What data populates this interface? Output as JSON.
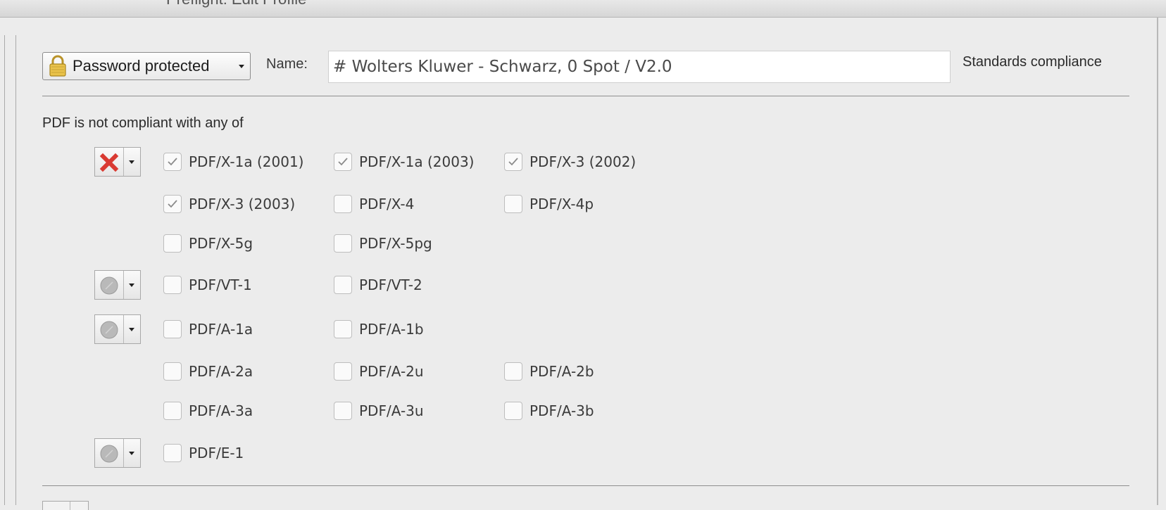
{
  "window": {
    "title": "Preflight: Edit Profile"
  },
  "header": {
    "lock_popup": {
      "label": "Password protected",
      "icon": "lock-icon"
    },
    "name_label": "Name:",
    "name_value": "# Wolters Kluwer - Schwarz, 0 Spot / V2.0",
    "section_title": "Standards compliance"
  },
  "compliance": {
    "intro": "PDF is not compliant with any of",
    "groups": [
      {
        "status": "error",
        "status_icon": "red-x-icon",
        "items": [
          {
            "label": "PDF/X-1a (2001)",
            "checked": true
          },
          {
            "label": "PDF/X-1a (2003)",
            "checked": true
          },
          {
            "label": "PDF/X-3 (2002)",
            "checked": true
          },
          {
            "label": "PDF/X-3 (2003)",
            "checked": true
          },
          {
            "label": "PDF/X-4",
            "checked": false
          },
          {
            "label": "PDF/X-4p",
            "checked": false
          },
          {
            "label": "PDF/X-5g",
            "checked": false
          },
          {
            "label": "PDF/X-5pg",
            "checked": false
          }
        ]
      },
      {
        "status": "inactive",
        "status_icon": "gray-circle-icon",
        "items": [
          {
            "label": "PDF/VT-1",
            "checked": false
          },
          {
            "label": "PDF/VT-2",
            "checked": false
          }
        ]
      },
      {
        "status": "inactive",
        "status_icon": "gray-circle-icon",
        "items": [
          {
            "label": "PDF/A-1a",
            "checked": false
          },
          {
            "label": "PDF/A-1b",
            "checked": false
          },
          {
            "label": "PDF/A-2a",
            "checked": false
          },
          {
            "label": "PDF/A-2u",
            "checked": false
          },
          {
            "label": "PDF/A-2b",
            "checked": false
          },
          {
            "label": "PDF/A-3a",
            "checked": false
          },
          {
            "label": "PDF/A-3u",
            "checked": false
          },
          {
            "label": "PDF/A-3b",
            "checked": false
          }
        ]
      },
      {
        "status": "inactive",
        "status_icon": "gray-circle-icon",
        "items": [
          {
            "label": "PDF/E-1",
            "checked": false
          }
        ]
      }
    ]
  },
  "colors": {
    "error_red": "#d93a32",
    "inactive_gray": "#b9b9b9",
    "checkmark": "#8a8a8a"
  }
}
